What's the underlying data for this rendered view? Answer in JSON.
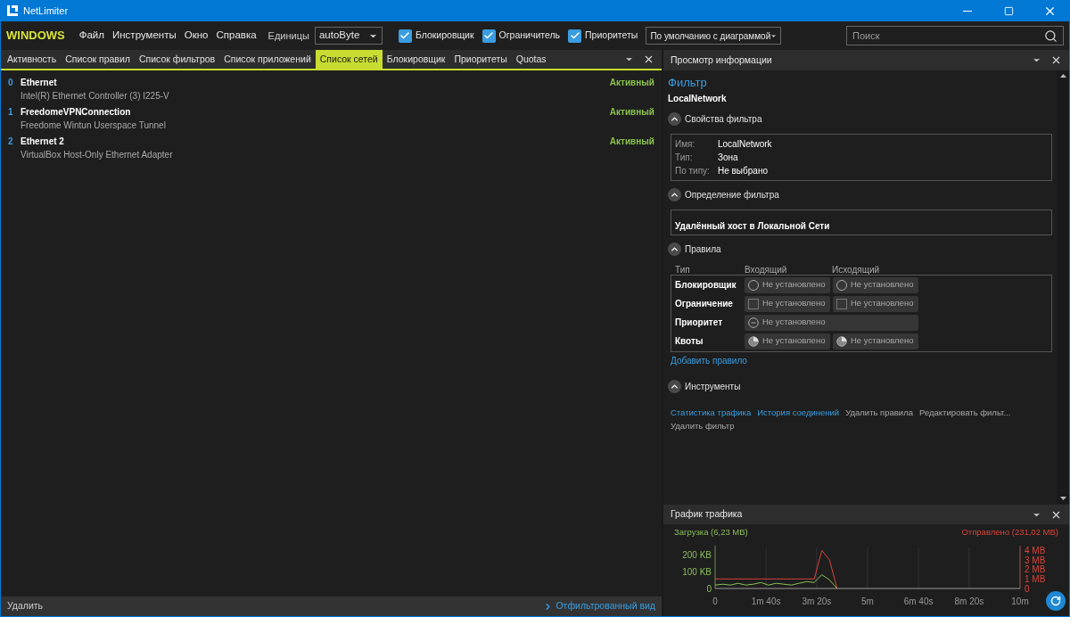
{
  "window": {
    "title": "NetLimiter"
  },
  "menubar": {
    "brand": "WINDOWS",
    "menus": [
      "Файл",
      "Инструменты",
      "Окно",
      "Справка"
    ],
    "units_label": "Единицы",
    "units_value": "autoByte",
    "toggles": [
      {
        "label": "Блокировщик",
        "checked": true
      },
      {
        "label": "Ограничитель",
        "checked": true
      },
      {
        "label": "Приоритеты",
        "checked": true
      }
    ],
    "view_value": "По умолчанию с диаграммой",
    "search": {
      "placeholder": "Поиск"
    }
  },
  "tabs": [
    {
      "label": "Активность",
      "selected": false
    },
    {
      "label": "Список правил",
      "selected": false
    },
    {
      "label": "Список фильтров",
      "selected": false
    },
    {
      "label": "Список приложений",
      "selected": false
    },
    {
      "label": "Список сетей",
      "selected": true
    },
    {
      "label": "Блокировщик",
      "selected": false
    },
    {
      "label": "Приоритеты",
      "selected": false
    },
    {
      "label": "Quotas",
      "selected": false
    }
  ],
  "networks": [
    {
      "index": "0",
      "name": "Ethernet",
      "adapter": "Intel(R) Ethernet Controller (3) I225-V",
      "status": "Активный"
    },
    {
      "index": "1",
      "name": "FreedomeVPNConnection",
      "adapter": "Freedome Wintun Userspace Tunnel",
      "status": "Активный"
    },
    {
      "index": "2",
      "name": "Ethernet 2",
      "adapter": "VirtualBox Host-Only Ethernet Adapter",
      "status": "Активный"
    }
  ],
  "left_footer": {
    "delete": "Удалить",
    "filtered_view": "Отфильтрованный вид"
  },
  "info_panel": {
    "title": "Просмотр информации",
    "heading": "Фильтр",
    "filter_name": "LocalNetwork",
    "properties": {
      "title": "Свойства фильтра",
      "rows": [
        {
          "label": "Имя:",
          "value": "LocalNetwork"
        },
        {
          "label": "Тип:",
          "value": "Зона"
        },
        {
          "label": "По типу:",
          "value": "Не выбрано"
        }
      ]
    },
    "definition": {
      "title": "Определение фильтра",
      "text": "Удалённый хост в Локальной Сети"
    },
    "rules": {
      "title": "Правила",
      "columns": [
        "Тип",
        "Входящий",
        "Исходящий"
      ],
      "rows": [
        {
          "label": "Блокировщик",
          "kind": "radio",
          "cells": [
            "Не установлено",
            "Не установлено"
          ]
        },
        {
          "label": "Ограничение",
          "kind": "checkbox",
          "cells": [
            "Не установлено",
            "Не установлено"
          ]
        },
        {
          "label": "Приоритет",
          "kind": "priority",
          "cells": [
            "Не установлено"
          ]
        },
        {
          "label": "Квоты",
          "kind": "quota",
          "cells": [
            "Не установлено",
            "Не установлено"
          ]
        }
      ],
      "add": "Добавить правило"
    },
    "tools": {
      "title": "Инструменты",
      "links": [
        {
          "label": "Статистика трафика",
          "enabled": true
        },
        {
          "label": "История соединений",
          "enabled": true
        },
        {
          "label": "Удалить правила",
          "enabled": false
        },
        {
          "label": "Редактировать фильт...",
          "enabled": false
        },
        {
          "label": "Удалить фильтр",
          "enabled": false
        }
      ]
    }
  },
  "traffic_panel": {
    "title": "График трафика",
    "chart_data": {
      "type": "line",
      "x": [
        0,
        0.25,
        0.5,
        0.75,
        1,
        1.25,
        1.5,
        1.75,
        2,
        2.25,
        2.5,
        2.75,
        3,
        3.25,
        3.5,
        3.75,
        4
      ],
      "series": [
        {
          "name": "Загрузка (6,23 MB)",
          "color": "#8bbf5a",
          "values": [
            20,
            25,
            20,
            30,
            20,
            25,
            35,
            20,
            30,
            25,
            20,
            30,
            40,
            35,
            80,
            50,
            0
          ]
        },
        {
          "name": "Отправлено (231,02 MB)",
          "color": "#d9443a",
          "axis": "y2",
          "values": [
            1,
            1,
            1,
            1,
            1,
            1,
            1,
            1,
            1,
            1,
            1,
            1,
            1,
            1,
            4,
            3,
            0
          ]
        }
      ],
      "xlim": [
        0,
        10
      ],
      "ylim": [
        0,
        250
      ],
      "grid": true,
      "y2lim": [
        0,
        4.5
      ],
      "y2ticks": [
        {
          "value": 4,
          "label": "4 MB"
        },
        {
          "value": 3,
          "label": "3 MB"
        },
        {
          "value": 2,
          "label": "2 MB"
        },
        {
          "value": 1,
          "label": "1 MB"
        },
        {
          "value": 0,
          "label": "0"
        }
      ],
      "xticks": [
        {
          "value": 0,
          "label": "0"
        },
        {
          "value": 1.67,
          "label": "1m 40s"
        },
        {
          "value": 3.33,
          "label": "3m 20s"
        },
        {
          "value": 5,
          "label": "5m"
        },
        {
          "value": 6.67,
          "label": "6m 40s"
        },
        {
          "value": 8.33,
          "label": "8m 20s"
        },
        {
          "value": 10,
          "label": "10m"
        }
      ],
      "yticks": [
        {
          "value": 200,
          "label": "200 KB"
        },
        {
          "value": 100,
          "label": "100 KB"
        },
        {
          "value": 0,
          "label": "0"
        }
      ]
    }
  }
}
